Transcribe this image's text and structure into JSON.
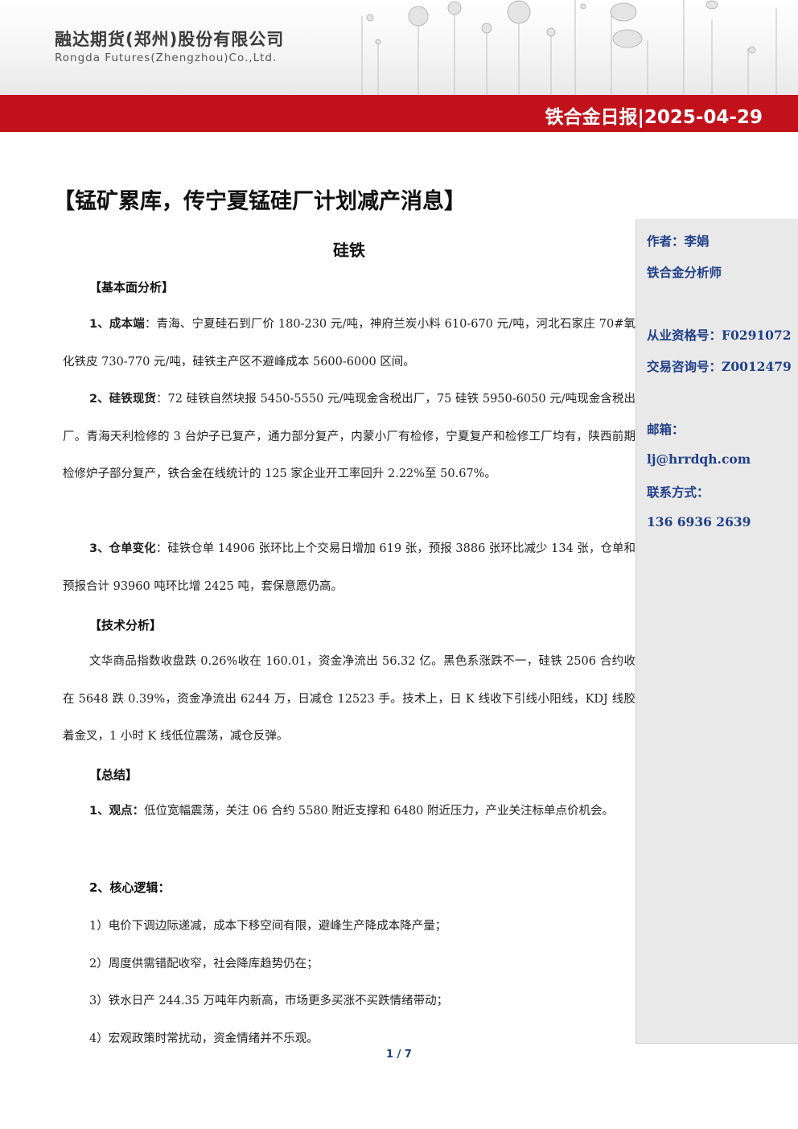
{
  "header": {
    "company_cn": "融达期货(郑州)股份有限公司",
    "company_en": "Rongda Futures(Zhengzhou)Co.,Ltd.",
    "report_title": "铁合金日报|2025-04-29",
    "bar_color": "#c1121c"
  },
  "title": "【锰矿累库，传宁夏锰硅厂计划减产消息】",
  "subtitle": "硅铁",
  "sections": {
    "fundamental": {
      "heading": "【基本面分析】",
      "cost_lead": "1、成本端",
      "cost_text": "：青海、宁夏硅石到厂价 180-230 元/吨，神府兰炭小料 610-670 元/吨，河北石家庄 70#氧化铁皮 730-770 元/吨，硅铁主产区不避峰成本 5600-6000 区间。",
      "spot_lead": "2、硅铁现货",
      "spot_text": "：72 硅铁自然块报 5450-5550 元/吨现金含税出厂，75 硅铁 5950-6050 元/吨现金含税出厂。青海天利检修的 3 台炉子已复产，通力部分复产，内蒙小厂有检修，宁夏复产和检修工厂均有，陕西前期检修炉子部分复产，铁合金在线统计的 125 家企业开工率回升 2.22%至 50.67%。",
      "warrant_lead": "3、仓单变化",
      "warrant_text": "：硅铁仓单 14906 张环比上个交易日增加 619 张，预报 3886 张环比减少 134 张，仓单和预报合计 93960 吨环比增 2425 吨，套保意愿仍高。"
    },
    "technical": {
      "heading": "【技术分析】",
      "text": "文华商品指数收盘跌 0.26%收在 160.01，资金净流出 56.32 亿。黑色系涨跌不一，硅铁 2506 合约收在 5648 跌 0.39%，资金净流出 6244 万，日减仓 12523 手。技术上，日 K 线收下引线小阳线，KDJ 线胶着金叉，1 小时 K 线低位震荡，减仓反弹。"
    },
    "summary": {
      "heading": "【总结】",
      "view_lead": "1、观点：",
      "view_text": "低位宽幅震荡，关注 06 合约 5580 附近支撑和 6480 附近压力，产业关注标单点价机会。",
      "logic_heading": "2、核心逻辑：",
      "logic_items": [
        "1）电价下调边际递减，成本下移空间有限，避峰生产降成本降产量；",
        "2）周度供需错配收窄，社会降库趋势仍在；",
        "3）铁水日产 244.35 万吨年内新高，市场更多买涨不买跌情绪带动；",
        "4）宏观政策时常扰动，资金情绪并不乐观。"
      ]
    }
  },
  "sidebar": {
    "author": "作者：李娟",
    "role": "铁合金分析师",
    "license": "从业资格号：F0291072",
    "consult": "交易咨询号：Z0012479",
    "email_label": "邮箱：",
    "email": "lj@hrrdqh.com",
    "contact_label": "联系方式：",
    "phone": "136 6936 2639"
  },
  "footer": {
    "page": "1 / 7"
  }
}
